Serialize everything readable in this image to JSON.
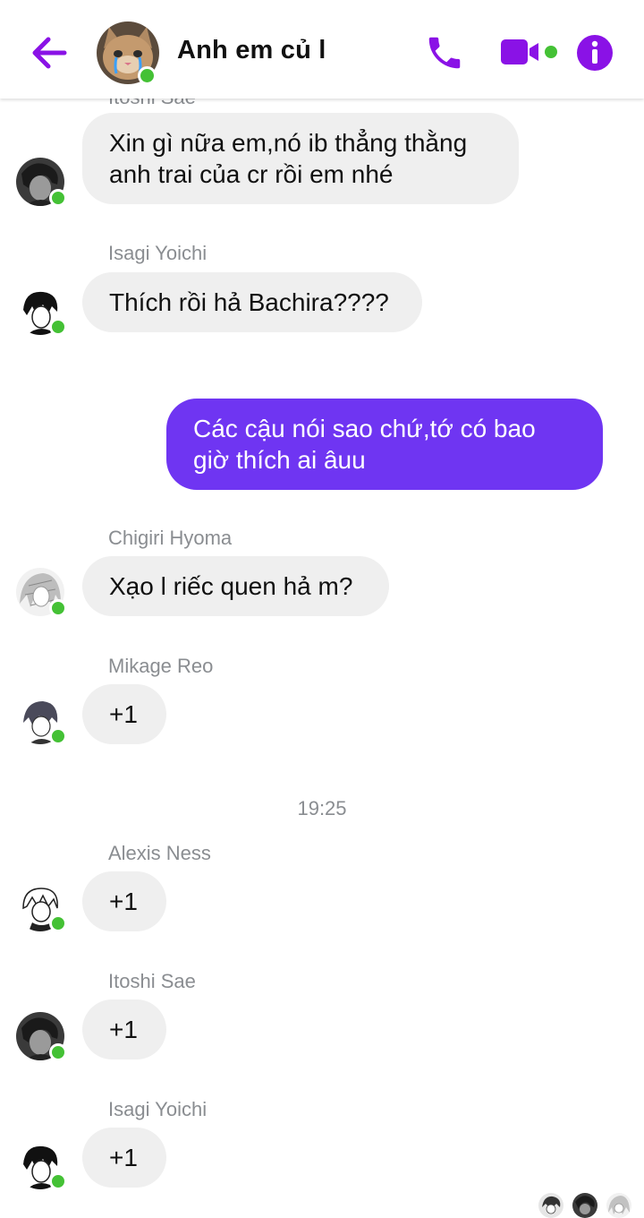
{
  "header": {
    "title": "Anh em củ l",
    "accent_color": "#8a12e6",
    "online_color": "#44c135",
    "icons": [
      "back-arrow-icon",
      "phone-icon",
      "video-camera-icon",
      "info-icon"
    ]
  },
  "messages": [
    {
      "sender": "Itoshi Sae",
      "text_lines": [
        "Xin gì nữa em,nó ib thẳng thằng",
        "anh trai của cr rồi em nhé"
      ],
      "online": true
    },
    {
      "sender": "Isagi Yoichi",
      "text_lines": [
        "Thích rồi hả Bachira????"
      ],
      "online": true
    },
    {
      "sender": "",
      "mine": true,
      "text_lines": [
        "Các cậu nói sao chứ,tớ có bao",
        "giờ thích ai âuu"
      ]
    },
    {
      "sender": "Chigiri Hyoma",
      "text_lines": [
        "Xạo l riếc quen hả m?"
      ],
      "online": true
    },
    {
      "sender": "Mikage Reo",
      "text_lines": [
        "+1"
      ],
      "online": true
    },
    {
      "timestamp": "19:25"
    },
    {
      "sender": "Alexis Ness",
      "text_lines": [
        "+1"
      ],
      "online": true
    },
    {
      "sender": "Itoshi Sae",
      "text_lines": [
        "+1"
      ],
      "online": true
    },
    {
      "sender": "Isagi Yoichi",
      "text_lines": [
        "+1"
      ],
      "online": true
    }
  ],
  "colors": {
    "my_bubble": "#6f35f2",
    "their_bubble": "#efefef",
    "meta_text": "#8a8d91"
  }
}
